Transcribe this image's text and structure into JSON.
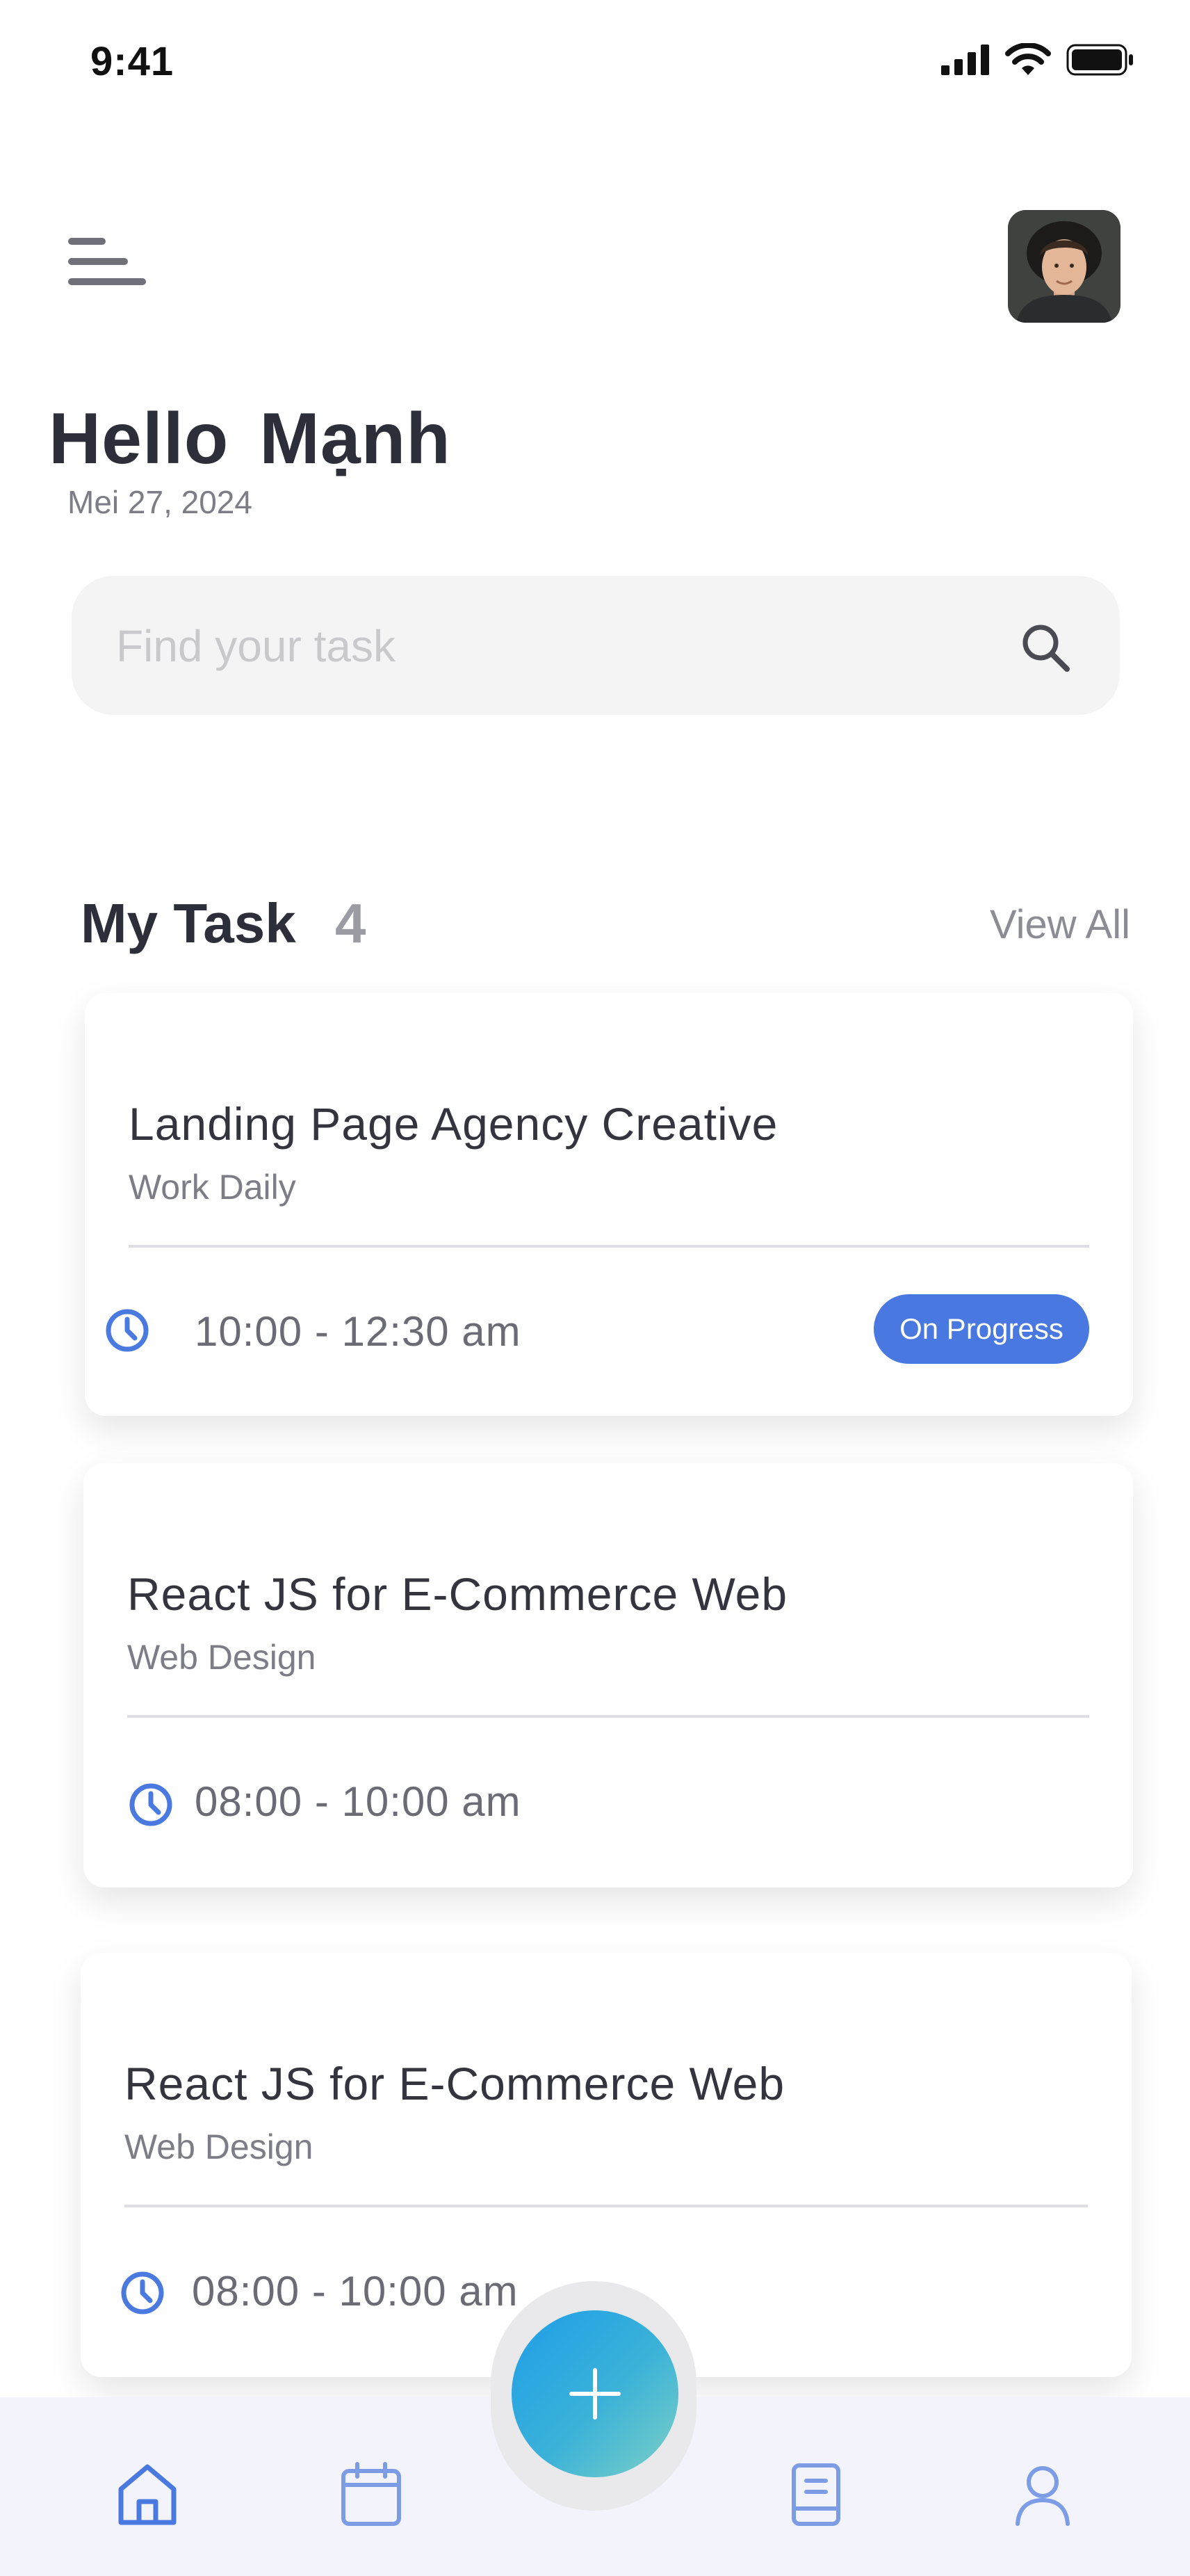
{
  "status_bar": {
    "time": "9:41"
  },
  "header": {
    "greeting_word": "Hello",
    "user_name": "Mạnh",
    "date": "Mei 27, 2024"
  },
  "search": {
    "placeholder": "Find your task"
  },
  "section": {
    "title": "My Task",
    "count": "4",
    "view_all": "View All"
  },
  "tasks": [
    {
      "title": "Landing Page Agency Creative",
      "category": "Work Daily",
      "time": "10:00 - 12:30 am",
      "status": "On Progress"
    },
    {
      "title": "React JS for E-Commerce Web",
      "category": "Web Design",
      "time": "08:00 - 10:00 am"
    },
    {
      "title": "React JS for E-Commerce Web",
      "category": "Web Design",
      "time": "08:00 - 10:00 am"
    }
  ],
  "nav": {
    "items": [
      "home-icon",
      "calendar-icon",
      "add-icon",
      "book-icon",
      "profile-icon"
    ]
  },
  "colors": {
    "accent": "#4878E0",
    "fab_gradient_start": "#1F9EE8",
    "fab_gradient_end": "#7FD1C6",
    "nav_background": "#F3F3FB"
  }
}
